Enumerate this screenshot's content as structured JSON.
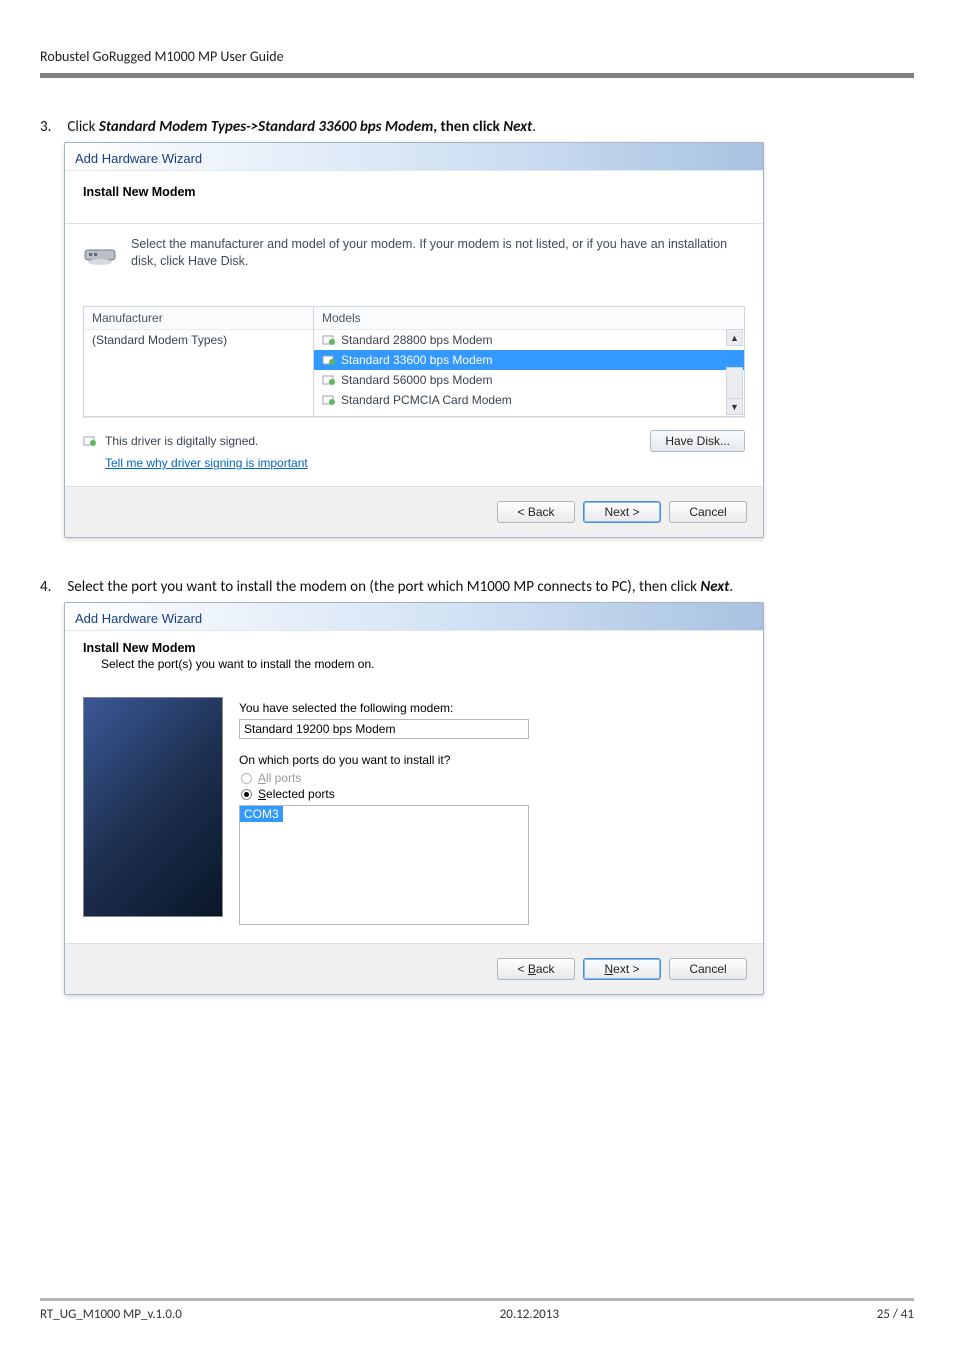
{
  "page": {
    "header": "Robustel GoRugged M1000 MP User Guide",
    "footer_left": "RT_UG_M1000 MP_v.1.0.0",
    "footer_center": "20.12.2013",
    "footer_right": "25 / 41"
  },
  "steps": {
    "s3": {
      "num": "3.",
      "pre": "Click ",
      "bi1": "Standard Modem Types->Standard 33600 bps Modem",
      "mid": ", then click ",
      "bi2": "Next",
      "post": "."
    },
    "s4": {
      "num": "4.",
      "pre": "Select the port you want to install the modem on (the port which M1000 MP connects to PC), then click ",
      "bi1": "Next",
      "post": "."
    }
  },
  "wiz1": {
    "title": "Add Hardware Wizard",
    "header": "Install New Modem",
    "info": "Select the manufacturer and model of your modem. If your modem is not listed, or if you have an installation disk, click Have Disk.",
    "col_left": "Manufacturer",
    "col_right": "Models",
    "left_item": "(Standard Modem Types)",
    "models": {
      "m0": "Standard 28800 bps Modem",
      "m1": "Standard 33600 bps Modem",
      "m2": "Standard 56000 bps Modem",
      "m3": "Standard PCMCIA Card Modem"
    },
    "signed": "This driver is digitally signed.",
    "tell": "Tell me why driver signing is important",
    "have_disk": "Have Disk...",
    "back": "< Back",
    "next": "Next >",
    "cancel": "Cancel"
  },
  "wiz2": {
    "title": "Add Hardware Wizard",
    "header": "Install New Modem",
    "sub": "Select the port(s) you want to install the modem on.",
    "sel_label": "You have selected the following modem:",
    "sel_value": "Standard 19200 bps Modem",
    "q": "On which ports do you want to install it?",
    "r_all_pre": "A",
    "r_all_rest": "ll ports",
    "r_sel_pre": "S",
    "r_sel_rest": "elected ports",
    "port": "COM3",
    "back_pre": "< ",
    "back_u": "B",
    "back_rest": "ack",
    "next_u": "N",
    "next_rest": "ext >",
    "cancel": "Cancel"
  }
}
